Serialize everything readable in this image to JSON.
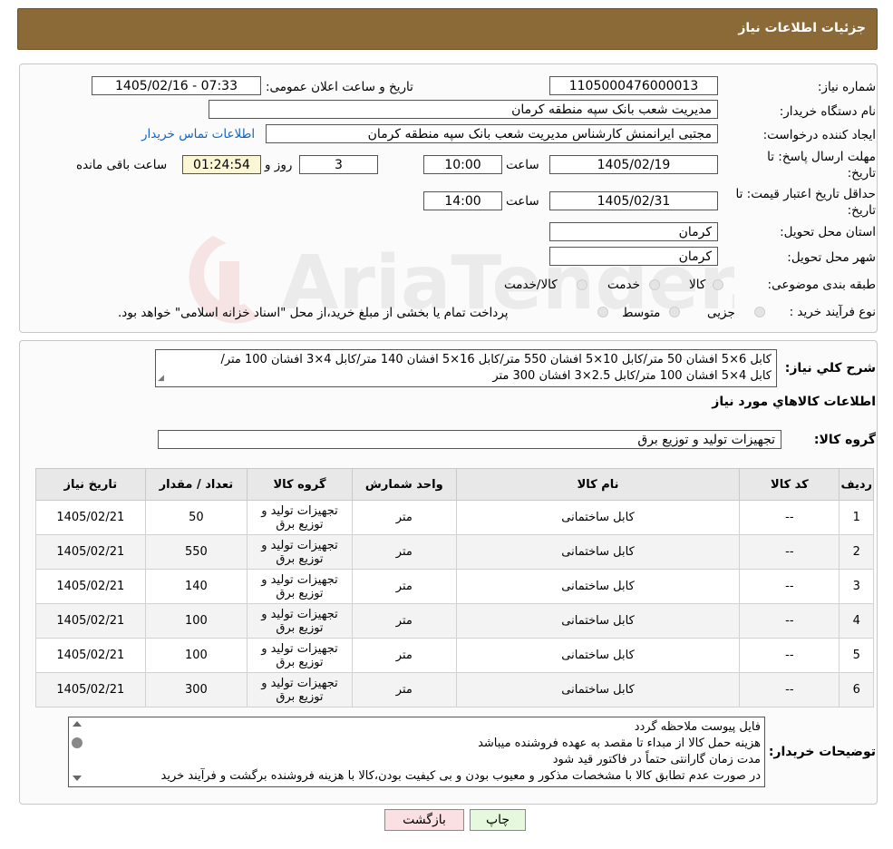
{
  "header": {
    "title": "جزئیات اطلاعات نیاز"
  },
  "form": {
    "need_number_label": "شماره نیاز:",
    "need_number": "1105000476000013",
    "announce_label": "تاریخ و ساعت اعلان عمومی:",
    "announce_value": "1405/02/16 - 07:33",
    "buyer_label": "نام دستگاه خریدار:",
    "buyer_value": "مدیریت شعب بانک سپه منطقه کرمان",
    "creator_label": "ایجاد کننده درخواست:",
    "creator_value": "مجتبی ایرانمنش کارشناس مدیریت شعب بانک سپه منطقه کرمان",
    "contact_link": "اطلاعات تماس خریدار",
    "deadline_label_1": "مهلت ارسال پاسخ: تا",
    "deadline_label_2": "تاریخ:",
    "deadline_date": "1405/02/19",
    "time_label": "ساعت",
    "deadline_time": "10:00",
    "days_value": "3",
    "days_label": "روز و",
    "remaining_time": "01:24:54",
    "remaining_label": "ساعت باقی مانده",
    "validity_label_1": "حداقل تاریخ اعتبار قیمت: تا",
    "validity_label_2": "تاریخ:",
    "validity_date": "1405/02/31",
    "validity_time": "14:00",
    "province_label": "استان محل تحویل:",
    "province_value": "کرمان",
    "city_label": "شهر محل تحویل:",
    "city_value": "کرمان",
    "category_label": "طبقه بندی موضوعی:",
    "category_options": [
      "کالا",
      "خدمت",
      "کالا/خدمت"
    ],
    "process_label": "نوع فرآیند خرید :",
    "process_options": [
      "جزیی",
      "متوسط"
    ],
    "payment_note": "پرداخت تمام یا بخشی از مبلغ خرید،از محل \"اسناد خزانه اسلامی\" خواهد بود."
  },
  "summary": {
    "label": "شرح کلي نياز:",
    "line1": "کابل 6×5 افشان 50 متر/کابل 10×5 افشان 550 متر/کابل 16×5 افشان 140 متر/کابل 4×3 افشان 100 متر/",
    "line2": "کابل 4×5 افشان 100 متر/کابل 2.5×3 افشان 300 متر",
    "items_title": "اطلاعات کالاهاي مورد نياز",
    "group_label": "گروه کالا:",
    "group_value": "تجهیزات تولید و توزیع برق"
  },
  "table": {
    "headers": [
      "رديف",
      "کد کالا",
      "نام کالا",
      "واحد شمارش",
      "گروه کالا",
      "تعداد / مقدار",
      "تاريخ نياز"
    ],
    "rows": [
      {
        "row": "1",
        "code": "--",
        "name": "کابل ساختمانی",
        "unit": "متر",
        "group": "تجهیزات تولید و توزیع برق",
        "qty": "50",
        "date": "1405/02/21"
      },
      {
        "row": "2",
        "code": "--",
        "name": "کابل ساختمانی",
        "unit": "متر",
        "group": "تجهیزات تولید و توزیع برق",
        "qty": "550",
        "date": "1405/02/21"
      },
      {
        "row": "3",
        "code": "--",
        "name": "کابل ساختمانی",
        "unit": "متر",
        "group": "تجهیزات تولید و توزیع برق",
        "qty": "140",
        "date": "1405/02/21"
      },
      {
        "row": "4",
        "code": "--",
        "name": "کابل ساختمانی",
        "unit": "متر",
        "group": "تجهیزات تولید و توزیع برق",
        "qty": "100",
        "date": "1405/02/21"
      },
      {
        "row": "5",
        "code": "--",
        "name": "کابل ساختمانی",
        "unit": "متر",
        "group": "تجهیزات تولید و توزیع برق",
        "qty": "100",
        "date": "1405/02/21"
      },
      {
        "row": "6",
        "code": "--",
        "name": "کابل ساختمانی",
        "unit": "متر",
        "group": "تجهیزات تولید و توزیع برق",
        "qty": "300",
        "date": "1405/02/21"
      }
    ]
  },
  "notes": {
    "label": "توضیحات خریدار:",
    "lines": [
      "فایل پیوست ملاحظه گردد",
      "هزینه حمل کالا از مبداء تا مقصد به عهده فروشنده میباشد",
      "مدت زمان گارانتی حتماً در فاکتور قید شود",
      "در صورت عدم تطابق کالا با مشخصات مذکور و معیوب بودن و بی کیفیت بودن،کالا با هزینه فروشنده برگشت و فرآیند خرید"
    ]
  },
  "buttons": {
    "print": "چاپ",
    "back": "بازگشت"
  },
  "watermark": {
    "text": "AriaTender.neT"
  },
  "colors": {
    "header_bg": "#8b6a37",
    "link": "#1565c0",
    "print_bg": "#e6f8dd",
    "back_bg": "#fbe0e3"
  }
}
